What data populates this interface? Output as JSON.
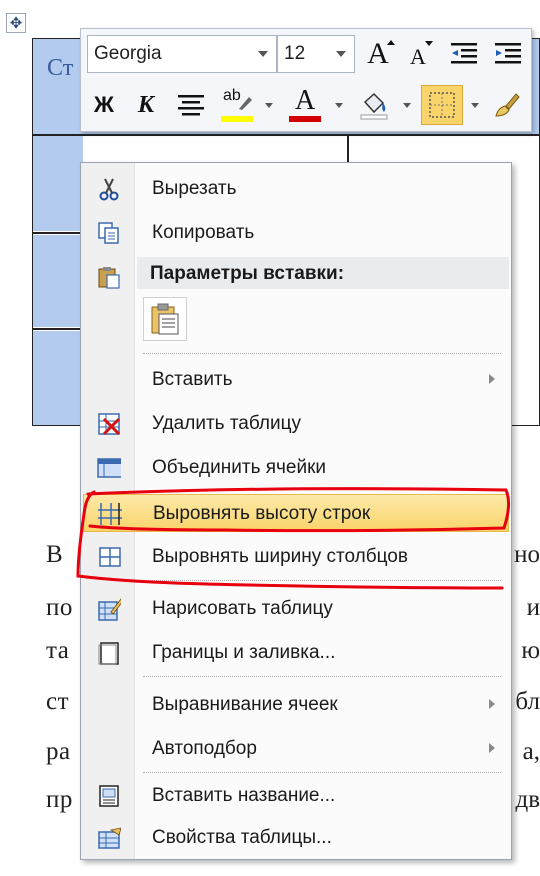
{
  "document": {
    "table_cell_text": "Ст",
    "paragraph_left": [
      "В",
      "по",
      "та",
      "ст",
      "ра",
      "пр"
    ],
    "paragraph_right": [
      "но",
      "и",
      "ю",
      "бл",
      "а,",
      "дв"
    ]
  },
  "mini_toolbar": {
    "font_name": "Georgia",
    "font_size": "12",
    "grow_font_glyph": "A",
    "shrink_font_glyph": "A",
    "bold_glyph": "Ж",
    "italic_glyph": "К",
    "highlight_glyph": "ab",
    "font_color_glyph": "A",
    "colors": {
      "highlight": "#ffff00",
      "font_color": "#d40000",
      "borders_active": "#f9d46a"
    }
  },
  "context_menu": {
    "items": [
      {
        "label": "Вырезать",
        "icon": "scissors-icon"
      },
      {
        "label": "Копировать",
        "icon": "copy-icon"
      },
      {
        "label": "Параметры вставки:",
        "icon": "paste-icon"
      },
      {
        "label": "Вставить",
        "icon": ""
      },
      {
        "label": "Удалить таблицу",
        "icon": "delete-table-icon"
      },
      {
        "label": "Объединить ячейки",
        "icon": "merge-cells-icon"
      },
      {
        "label": "Выровнять высоту строк",
        "icon": "distribute-rows-icon"
      },
      {
        "label": "Выровнять ширину столбцов",
        "icon": "distribute-columns-icon"
      },
      {
        "label": "Нарисовать таблицу",
        "icon": "draw-table-icon"
      },
      {
        "label": "Границы и заливка...",
        "icon": "borders-shading-icon"
      },
      {
        "label": "Выравнивание ячеек",
        "icon": ""
      },
      {
        "label": "Автоподбор",
        "icon": ""
      },
      {
        "label": "Вставить название...",
        "icon": "insert-caption-icon"
      },
      {
        "label": "Свойства таблицы...",
        "icon": "table-properties-icon"
      }
    ],
    "highlighted_item": "Выровнять высоту строк",
    "annotation_color": "#e8000e"
  }
}
